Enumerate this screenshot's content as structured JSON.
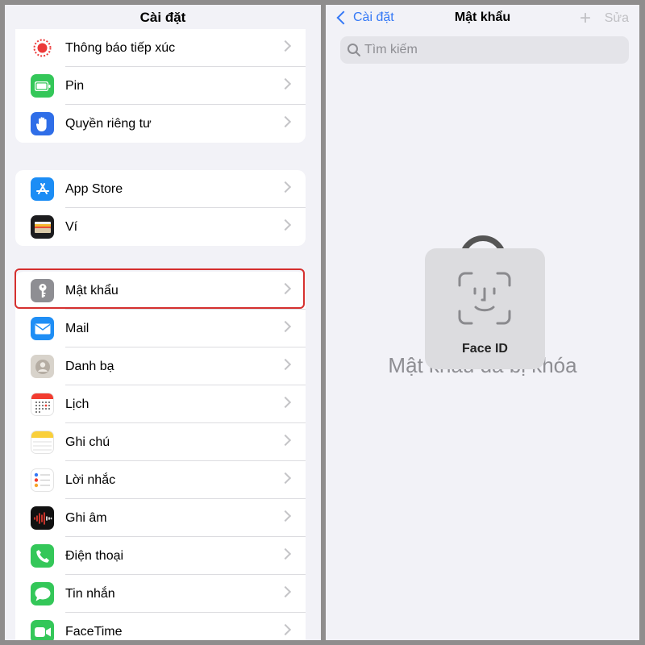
{
  "settings": {
    "title": "Cài đặt",
    "group1": [
      {
        "label": "Thông báo tiếp xúc",
        "icon": "exposure-notifications-icon"
      },
      {
        "label": "Pin",
        "icon": "battery-icon"
      },
      {
        "label": "Quyền riêng tư",
        "icon": "privacy-hand-icon"
      }
    ],
    "group2": [
      {
        "label": "App Store",
        "icon": "app-store-icon"
      },
      {
        "label": "Ví",
        "icon": "wallet-icon"
      }
    ],
    "group3": [
      {
        "label": "Mật khẩu",
        "icon": "key-icon"
      },
      {
        "label": "Mail",
        "icon": "mail-icon"
      },
      {
        "label": "Danh bạ",
        "icon": "contacts-icon"
      },
      {
        "label": "Lịch",
        "icon": "calendar-icon"
      },
      {
        "label": "Ghi chú",
        "icon": "notes-icon"
      },
      {
        "label": "Lời nhắc",
        "icon": "reminders-icon"
      },
      {
        "label": "Ghi âm",
        "icon": "voice-memos-icon"
      },
      {
        "label": "Điện thoại",
        "icon": "phone-icon"
      },
      {
        "label": "Tin nhắn",
        "icon": "messages-icon"
      },
      {
        "label": "FaceTime",
        "icon": "facetime-icon"
      }
    ]
  },
  "passwords": {
    "back_label": "Cài đặt",
    "title": "Mật khẩu",
    "add_symbol": "+",
    "edit_label": "Sửa",
    "search_placeholder": "Tìm kiếm",
    "locked_message": "Mật khẩu đã bị khóa",
    "faceid_label": "Face ID"
  },
  "colors": {
    "accent": "#3478f6",
    "highlight": "#d5302f"
  }
}
